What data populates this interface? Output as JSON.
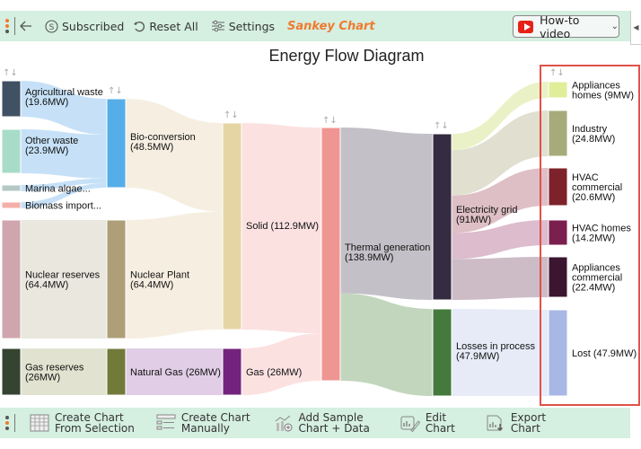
{
  "toolbar": {
    "back_icon": "arrow-left-icon",
    "subscribed_label": "Subscribed",
    "reset_label": "Reset All",
    "settings_label": "Settings",
    "brand_label": "Sankey Chart",
    "howto_label": "How-to video",
    "dots_colors": [
      "#f07a2e",
      "#f07a2e",
      "#555555"
    ]
  },
  "bottom_toolbar": {
    "items": [
      {
        "icon": "table-grid-icon",
        "line1": "Create Chart",
        "line2": "From Selection"
      },
      {
        "icon": "list-form-icon",
        "line1": "Create Chart",
        "line2": "Manually"
      },
      {
        "icon": "sample-data-icon",
        "line1": "Add Sample",
        "line2": "Chart + Data"
      },
      {
        "icon": "edit-chart-icon",
        "line1": "Edit",
        "line2": "Chart"
      },
      {
        "icon": "export-chart-icon",
        "line1": "Export",
        "line2": "Chart"
      }
    ]
  },
  "chart_data": {
    "type": "sankey",
    "title": "Energy Flow Diagram",
    "units": "MW",
    "nodes": [
      {
        "id": "agri",
        "name": "Agricultural waste",
        "value": 19.6,
        "column": 0,
        "color": "#3f5163",
        "label": "Agricultural waste",
        "sub": "(19.6MW)"
      },
      {
        "id": "other",
        "name": "Other waste",
        "value": 23.9,
        "column": 0,
        "color": "#a8dcc8",
        "label": "Other waste",
        "sub": "(23.9MW)"
      },
      {
        "id": "algae",
        "name": "Marina algae...",
        "value": 2.5,
        "column": 0,
        "color": "#b4c8c4",
        "label": "Marina algae...",
        "sub": ""
      },
      {
        "id": "biomass",
        "name": "Biomass import...",
        "value": 2.5,
        "column": 0,
        "color": "#f4b0a8",
        "label": "Biomass import...",
        "sub": ""
      },
      {
        "id": "nuclear_res",
        "name": "Nuclear reserves",
        "value": 64.4,
        "column": 0,
        "color": "#cfa6ae",
        "label": "Nuclear reserves",
        "sub": "(64.4MW)"
      },
      {
        "id": "gas_res",
        "name": "Gas reserves",
        "value": 26,
        "column": 0,
        "color": "#344430",
        "label": "Gas reserves",
        "sub": "(26MW)"
      },
      {
        "id": "bio",
        "name": "Bio-conversion",
        "value": 48.5,
        "column": 1,
        "color": "#56aee8",
        "label": "Bio-conversion",
        "sub": "(48.5MW)"
      },
      {
        "id": "nuclear_plant",
        "name": "Nuclear Plant",
        "value": 64.4,
        "column": 1,
        "color": "#ae9f78",
        "label": "Nuclear Plant",
        "sub": "(64.4MW)"
      },
      {
        "id": "natgas",
        "name": "Natural Gas",
        "value": 26,
        "column": 1,
        "color": "#727a3a",
        "label": "Natural Gas (26MW)",
        "sub": ""
      },
      {
        "id": "solid",
        "name": "Solid",
        "value": 112.9,
        "column": 2,
        "color": "#e6d5a4",
        "label": "Solid (112.9MW)",
        "sub": ""
      },
      {
        "id": "gas",
        "name": "Gas",
        "value": 26,
        "column": 2,
        "color": "#73237e",
        "label": "Gas (26MW)",
        "sub": ""
      },
      {
        "id": "thermal",
        "name": "Thermal generation",
        "value": 138.9,
        "column": 3,
        "color": "#ef9592",
        "label": "Thermal generation",
        "sub": "(138.9MW)"
      },
      {
        "id": "grid",
        "name": "Electricity grid",
        "value": 91,
        "column": 4,
        "color": "#352c41",
        "label": "Electricity grid",
        "sub": "(91MW)"
      },
      {
        "id": "losses",
        "name": "Losses in process",
        "value": 47.9,
        "column": 4,
        "color": "#447a3c",
        "label": "Losses in process",
        "sub": "(47.9MW)"
      },
      {
        "id": "app_homes",
        "name": "Appliances homes",
        "value": 9,
        "column": 5,
        "color": "#e0ee9a",
        "label": "Appliances",
        "sub": "homes (9MW)"
      },
      {
        "id": "industry",
        "name": "Industry",
        "value": 24.8,
        "column": 5,
        "color": "#a6ab7a",
        "label": "Industry",
        "sub": "(24.8MW)"
      },
      {
        "id": "hvac_com",
        "name": "HVAC commercial",
        "value": 20.6,
        "column": 5,
        "color": "#7d222a",
        "label": "HVAC",
        "sub": "commercial",
        "sub2": "(20.6MW)"
      },
      {
        "id": "hvac_homes",
        "name": "HVAC homes",
        "value": 14.2,
        "column": 5,
        "color": "#7a1f4e",
        "label": "HVAC homes",
        "sub": "(14.2MW)"
      },
      {
        "id": "app_com",
        "name": "Appliances commercial",
        "value": 22.4,
        "column": 5,
        "color": "#3c1530",
        "label": "Appliances",
        "sub": "commercial",
        "sub2": "(22.4MW)"
      },
      {
        "id": "lost",
        "name": "Lost",
        "value": 47.9,
        "column": 5,
        "color": "#a8b8e6",
        "label": "Lost (47.9MW)",
        "sub": ""
      }
    ],
    "links": [
      {
        "source": "agri",
        "target": "bio",
        "value": 19.6,
        "color": "#bcdcf6"
      },
      {
        "source": "other",
        "target": "bio",
        "value": 23.9,
        "color": "#bcdcf6"
      },
      {
        "source": "algae",
        "target": "bio",
        "value": 2.5,
        "color": "#bcdcf6"
      },
      {
        "source": "biomass",
        "target": "bio",
        "value": 2.5,
        "color": "#bcdcf6"
      },
      {
        "source": "nuclear_res",
        "target": "nuclear_plant",
        "value": 64.4,
        "color": "#e6e3d8"
      },
      {
        "source": "gas_res",
        "target": "natgas",
        "value": 26,
        "color": "#dcdec8"
      },
      {
        "source": "bio",
        "target": "solid",
        "value": 48.5,
        "color": "#f4ecdc"
      },
      {
        "source": "nuclear_plant",
        "target": "solid",
        "value": 64.4,
        "color": "#f4ecdc"
      },
      {
        "source": "natgas",
        "target": "gas",
        "value": 26,
        "color": "#dcc4e0"
      },
      {
        "source": "solid",
        "target": "thermal",
        "value": 112.9,
        "color": "#fbdcdc"
      },
      {
        "source": "gas",
        "target": "thermal",
        "value": 26,
        "color": "#fbdcdc"
      },
      {
        "source": "thermal",
        "target": "grid",
        "value": 91,
        "color": "#b9b6bd"
      },
      {
        "source": "thermal",
        "target": "losses",
        "value": 47.9,
        "color": "#b7cfb3"
      },
      {
        "source": "grid",
        "target": "app_homes",
        "value": 9,
        "color": "#e6eebc"
      },
      {
        "source": "grid",
        "target": "industry",
        "value": 24.8,
        "color": "#dad9c8"
      },
      {
        "source": "grid",
        "target": "hvac_com",
        "value": 20.6,
        "color": "#d8b4bc"
      },
      {
        "source": "grid",
        "target": "hvac_homes",
        "value": 14.2,
        "color": "#d6b0c4"
      },
      {
        "source": "grid",
        "target": "app_com",
        "value": 22.4,
        "color": "#c4b0bc"
      },
      {
        "source": "losses",
        "target": "lost",
        "value": 47.9,
        "color": "#e2e8f6"
      }
    ]
  }
}
